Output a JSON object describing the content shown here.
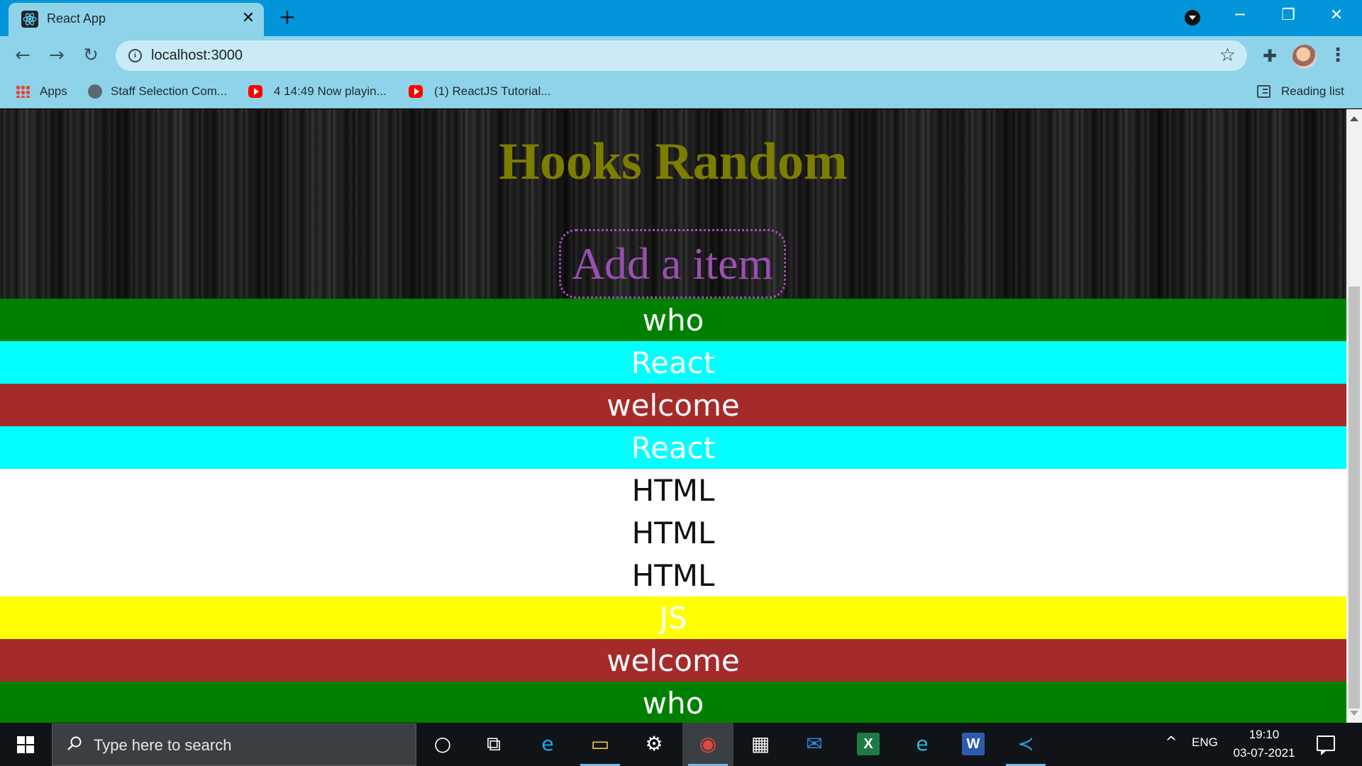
{
  "browser": {
    "tab": {
      "title": "React App",
      "close": "✕"
    },
    "new_tab": "+",
    "window_controls": {
      "minimize": "─",
      "restore": "❐",
      "close": "✕"
    },
    "nav": {
      "back": "←",
      "forward": "→",
      "reload": "↻"
    },
    "omnibox": {
      "url": "localhost:3000",
      "info": "i",
      "star": "☆"
    },
    "toolbar": {
      "extensions": "✚",
      "menu": "⋮"
    },
    "bookmarks": [
      {
        "label": "Apps",
        "icon": "apps-grid-icon"
      },
      {
        "label": "Staff Selection Com...",
        "icon": "globe-icon"
      },
      {
        "label": "4 14:49 Now playin...",
        "icon": "youtube-icon"
      },
      {
        "label": "(1) ReactJS Tutorial...",
        "icon": "youtube-icon"
      }
    ],
    "reading_list": "Reading list"
  },
  "page": {
    "title": "Hooks Random",
    "input_placeholder": "Add a item",
    "items": [
      {
        "text": "who",
        "bg": "#008000",
        "fg": "#ffffff"
      },
      {
        "text": "React",
        "bg": "#00ffff",
        "fg": "#ffffff"
      },
      {
        "text": "welcome",
        "bg": "#a52a2a",
        "fg": "#ffffff"
      },
      {
        "text": "React",
        "bg": "#00ffff",
        "fg": "#ffffff"
      },
      {
        "text": "HTML",
        "bg": "#ffffff",
        "fg": "#111111"
      },
      {
        "text": "HTML",
        "bg": "#ffffff",
        "fg": "#111111"
      },
      {
        "text": "HTML",
        "bg": "#ffffff",
        "fg": "#111111"
      },
      {
        "text": "JS",
        "bg": "#ffff00",
        "fg": "#ffffff"
      },
      {
        "text": "welcome",
        "bg": "#a52a2a",
        "fg": "#ffffff"
      },
      {
        "text": "who",
        "bg": "#008000",
        "fg": "#ffffff"
      }
    ],
    "colors": {
      "title": "#7d7d00",
      "input_border": "#9a4fb0"
    }
  },
  "taskbar": {
    "search_placeholder": "Type here to search",
    "apps": [
      {
        "name": "cortana-icon",
        "glyph": "○"
      },
      {
        "name": "task-view-icon",
        "glyph": "⧉"
      },
      {
        "name": "internet-explorer-icon",
        "glyph": "e"
      },
      {
        "name": "file-explorer-icon",
        "glyph": "▭"
      },
      {
        "name": "settings-icon",
        "glyph": "⚙"
      },
      {
        "name": "chrome-icon",
        "glyph": "◉"
      },
      {
        "name": "store-icon",
        "glyph": "▦"
      },
      {
        "name": "mail-icon",
        "glyph": "✉"
      },
      {
        "name": "excel-icon",
        "glyph": "X"
      },
      {
        "name": "edge-icon",
        "glyph": "e"
      },
      {
        "name": "word-icon",
        "glyph": "W"
      },
      {
        "name": "vscode-icon",
        "glyph": "≺"
      }
    ],
    "tray": {
      "chevron": "^",
      "language": "ENG",
      "time": "19:10",
      "date": "03-07-2021"
    }
  }
}
